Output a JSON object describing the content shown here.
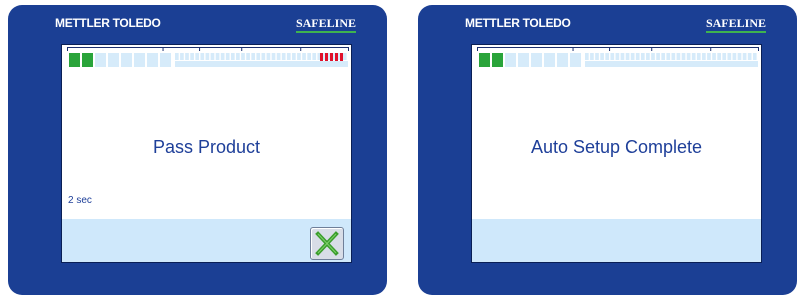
{
  "panels": [
    {
      "brand": "METTLER TOLEDO",
      "partner": "SAFELINE",
      "message": "Pass Product",
      "timer": "2 sec",
      "meter": {
        "green_segments": 2,
        "total_segments": 8,
        "red_alarm_bars": 5,
        "colors": {
          "green": "#2aa43a",
          "empty": "#d6ebfa",
          "red": "#e0102a",
          "tick": "#1b2f6e"
        }
      },
      "accept_button": {
        "icon": "check-x-icon",
        "color": "#3a9e2c"
      }
    },
    {
      "brand": "METTLER TOLEDO",
      "partner": "SAFELINE",
      "message": "Auto Setup Complete",
      "timer": "",
      "meter": {
        "green_segments": 2,
        "total_segments": 8,
        "red_alarm_bars": 0,
        "colors": {
          "green": "#2aa43a",
          "empty": "#d6ebfa",
          "red": "#e0102a",
          "tick": "#1b2f6e"
        }
      }
    }
  ],
  "colors": {
    "bezel": "#1b3f94",
    "screen": "#ffffff",
    "band": "#cfe8fb",
    "text": "#1e3f99",
    "underline": "#3fb34f"
  }
}
